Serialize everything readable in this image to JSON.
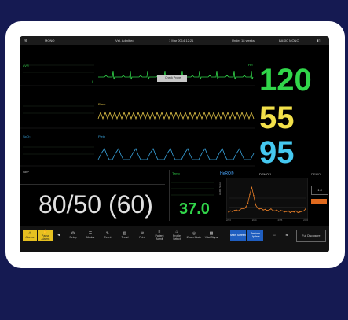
{
  "topbar": {
    "mode": "MONO",
    "patient": "Vst. Admitted",
    "date_time": "1 Mar 2014 12:21",
    "status": "Under 18 weeks",
    "profile": "BASIC MONO"
  },
  "ecg_panel": {
    "lead_a": "aVR",
    "lead_b": "II",
    "resp_label": "Resp",
    "spo2_label": "SpO₂",
    "pleth_label": "Pleth",
    "hr_value": "120",
    "resp_value": "55",
    "spo2_value": "95",
    "probe_message": "Check Probe"
  },
  "nibp": {
    "label": "NBP",
    "value": "80/50 (60)"
  },
  "temp": {
    "label": "Temp",
    "value": "37.0"
  },
  "trend": {
    "title": "HeRO®",
    "subtitle": "DEMO 1",
    "extra": "DEMO",
    "ylabel": "HeRO Score",
    "x_ticks": [
      "2/23",
      "2/24",
      "2/25",
      "2/26"
    ],
    "chart_data": {
      "type": "line",
      "x": [
        0,
        1,
        2,
        3,
        4,
        5,
        6,
        7,
        8,
        9,
        10,
        11,
        12,
        13,
        14,
        15,
        16,
        17,
        18,
        19,
        20,
        21,
        22,
        23,
        24,
        25,
        26,
        27,
        28,
        29,
        30,
        31,
        32,
        33,
        34,
        35,
        36,
        37,
        38,
        39,
        40
      ],
      "values": [
        0.8,
        1.0,
        0.9,
        1.1,
        1.2,
        1.0,
        1.3,
        1.5,
        1.4,
        1.8,
        2.5,
        4.2,
        5.6,
        4.0,
        2.2,
        1.6,
        1.4,
        1.5,
        1.2,
        1.3,
        1.1,
        1.2,
        1.4,
        1.1,
        1.0,
        1.2,
        0.9,
        1.1,
        1.0,
        0.8,
        0.9,
        1.0,
        0.7,
        0.9,
        0.8,
        1.0,
        0.7,
        0.8,
        0.9,
        1.0,
        1.4
      ],
      "ylim": [
        0,
        7
      ]
    },
    "score": "1.4"
  },
  "bottom_menu": {
    "items": [
      {
        "icon": "⚠",
        "label": "Alarms"
      },
      {
        "icon": "✋",
        "label": "Pause Alarms"
      },
      {
        "icon": "◀",
        "label": ""
      },
      {
        "icon": "⚙",
        "label": "Setup"
      },
      {
        "icon": "☰",
        "label": "Modes"
      },
      {
        "icon": "✎",
        "label": "Event"
      },
      {
        "icon": "▥",
        "label": "Trend"
      },
      {
        "icon": "✉",
        "label": "Print"
      },
      {
        "icon": "≡",
        "label": "Patient Admit"
      },
      {
        "icon": "⌂",
        "label": "Profile Select"
      },
      {
        "icon": "◎",
        "label": "Zoom Mode"
      },
      {
        "icon": "▦",
        "label": "Vital Signs"
      }
    ],
    "active_a": "Main Screen",
    "active_b": "Perform Update",
    "right_label": "Full Disclosure"
  }
}
